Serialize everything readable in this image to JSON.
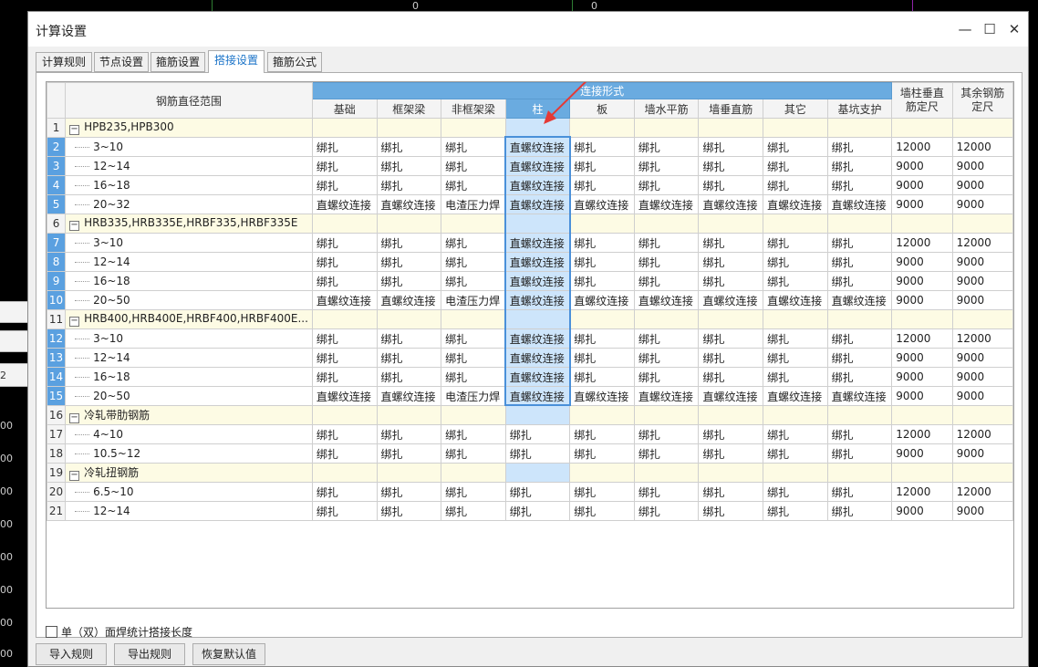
{
  "background": {
    "numbers": [
      "0",
      "0",
      "00",
      "00",
      "00",
      "00",
      "00",
      "00",
      "00",
      "00",
      "2"
    ]
  },
  "dialog": {
    "title": "计算设置",
    "minimize": "—",
    "maximize": "☐",
    "close": "✕"
  },
  "tabs": [
    "计算规则",
    "节点设置",
    "箍筋设置",
    "搭接设置",
    "箍筋公式"
  ],
  "active_tab": "搭接设置",
  "table": {
    "header_range": "钢筋直径范围",
    "header_group": "连接形式",
    "columns": [
      "基础",
      "框架梁",
      "非框架梁",
      "柱",
      "板",
      "墙水平筋",
      "墙垂直筋",
      "其它",
      "基坑支护"
    ],
    "header_wall_len": "墙柱垂直筋定尺",
    "header_other_len": "其余钢筋定尺",
    "rows": [
      {
        "num": "1",
        "group": true,
        "label": "HPB235,HPB300"
      },
      {
        "num": "2",
        "label": "3~10",
        "cells": [
          "绑扎",
          "绑扎",
          "绑扎",
          "直螺纹连接",
          "绑扎",
          "绑扎",
          "绑扎",
          "绑扎",
          "绑扎",
          "12000",
          "12000"
        ]
      },
      {
        "num": "3",
        "label": "12~14",
        "cells": [
          "绑扎",
          "绑扎",
          "绑扎",
          "直螺纹连接",
          "绑扎",
          "绑扎",
          "绑扎",
          "绑扎",
          "绑扎",
          "9000",
          "9000"
        ]
      },
      {
        "num": "4",
        "label": "16~18",
        "cells": [
          "绑扎",
          "绑扎",
          "绑扎",
          "直螺纹连接",
          "绑扎",
          "绑扎",
          "绑扎",
          "绑扎",
          "绑扎",
          "9000",
          "9000"
        ]
      },
      {
        "num": "5",
        "label": "20~32",
        "cells": [
          "直螺纹连接",
          "直螺纹连接",
          "电渣压力焊",
          "直螺纹连接",
          "直螺纹连接",
          "直螺纹连接",
          "直螺纹连接",
          "直螺纹连接",
          "直螺纹连接",
          "9000",
          "9000"
        ]
      },
      {
        "num": "6",
        "group": true,
        "label": "HRB335,HRB335E,HRBF335,HRBF335E"
      },
      {
        "num": "7",
        "label": "3~10",
        "cells": [
          "绑扎",
          "绑扎",
          "绑扎",
          "直螺纹连接",
          "绑扎",
          "绑扎",
          "绑扎",
          "绑扎",
          "绑扎",
          "12000",
          "12000"
        ]
      },
      {
        "num": "8",
        "label": "12~14",
        "cells": [
          "绑扎",
          "绑扎",
          "绑扎",
          "直螺纹连接",
          "绑扎",
          "绑扎",
          "绑扎",
          "绑扎",
          "绑扎",
          "9000",
          "9000"
        ]
      },
      {
        "num": "9",
        "label": "16~18",
        "cells": [
          "绑扎",
          "绑扎",
          "绑扎",
          "直螺纹连接",
          "绑扎",
          "绑扎",
          "绑扎",
          "绑扎",
          "绑扎",
          "9000",
          "9000"
        ]
      },
      {
        "num": "10",
        "label": "20~50",
        "cells": [
          "直螺纹连接",
          "直螺纹连接",
          "电渣压力焊",
          "直螺纹连接",
          "直螺纹连接",
          "直螺纹连接",
          "直螺纹连接",
          "直螺纹连接",
          "直螺纹连接",
          "9000",
          "9000"
        ]
      },
      {
        "num": "11",
        "group": true,
        "label": "HRB400,HRB400E,HRBF400,HRBF400E..."
      },
      {
        "num": "12",
        "label": "3~10",
        "cells": [
          "绑扎",
          "绑扎",
          "绑扎",
          "直螺纹连接",
          "绑扎",
          "绑扎",
          "绑扎",
          "绑扎",
          "绑扎",
          "12000",
          "12000"
        ]
      },
      {
        "num": "13",
        "label": "12~14",
        "cells": [
          "绑扎",
          "绑扎",
          "绑扎",
          "直螺纹连接",
          "绑扎",
          "绑扎",
          "绑扎",
          "绑扎",
          "绑扎",
          "9000",
          "9000"
        ]
      },
      {
        "num": "14",
        "label": "16~18",
        "cells": [
          "绑扎",
          "绑扎",
          "绑扎",
          "直螺纹连接",
          "绑扎",
          "绑扎",
          "绑扎",
          "绑扎",
          "绑扎",
          "9000",
          "9000"
        ]
      },
      {
        "num": "15",
        "label": "20~50",
        "cells": [
          "直螺纹连接",
          "直螺纹连接",
          "电渣压力焊",
          "直螺纹连接",
          "直螺纹连接",
          "直螺纹连接",
          "直螺纹连接",
          "直螺纹连接",
          "直螺纹连接",
          "9000",
          "9000"
        ]
      },
      {
        "num": "16",
        "group": true,
        "label": "冷轧带肋钢筋"
      },
      {
        "num": "17",
        "label": "4~10",
        "cells": [
          "绑扎",
          "绑扎",
          "绑扎",
          "绑扎",
          "绑扎",
          "绑扎",
          "绑扎",
          "绑扎",
          "绑扎",
          "12000",
          "12000"
        ]
      },
      {
        "num": "18",
        "label": "10.5~12",
        "cells": [
          "绑扎",
          "绑扎",
          "绑扎",
          "绑扎",
          "绑扎",
          "绑扎",
          "绑扎",
          "绑扎",
          "绑扎",
          "9000",
          "9000"
        ]
      },
      {
        "num": "19",
        "group": true,
        "label": "冷轧扭钢筋"
      },
      {
        "num": "20",
        "label": "6.5~10",
        "cells": [
          "绑扎",
          "绑扎",
          "绑扎",
          "绑扎",
          "绑扎",
          "绑扎",
          "绑扎",
          "绑扎",
          "绑扎",
          "12000",
          "12000"
        ]
      },
      {
        "num": "21",
        "label": "12~14",
        "cells": [
          "绑扎",
          "绑扎",
          "绑扎",
          "绑扎",
          "绑扎",
          "绑扎",
          "绑扎",
          "绑扎",
          "绑扎",
          "9000",
          "9000"
        ]
      }
    ]
  },
  "checkbox_label": "单（双）面焊统计搭接长度",
  "checkbox_checked": false,
  "buttons": {
    "import": "导入规则",
    "export": "导出规则",
    "restore": "恢复默认值"
  },
  "colors": {
    "header_blue": "#6aabe0",
    "selected_column": "#cde5fb",
    "group_row": "#fdfbe4",
    "arrow": "#e53935"
  }
}
